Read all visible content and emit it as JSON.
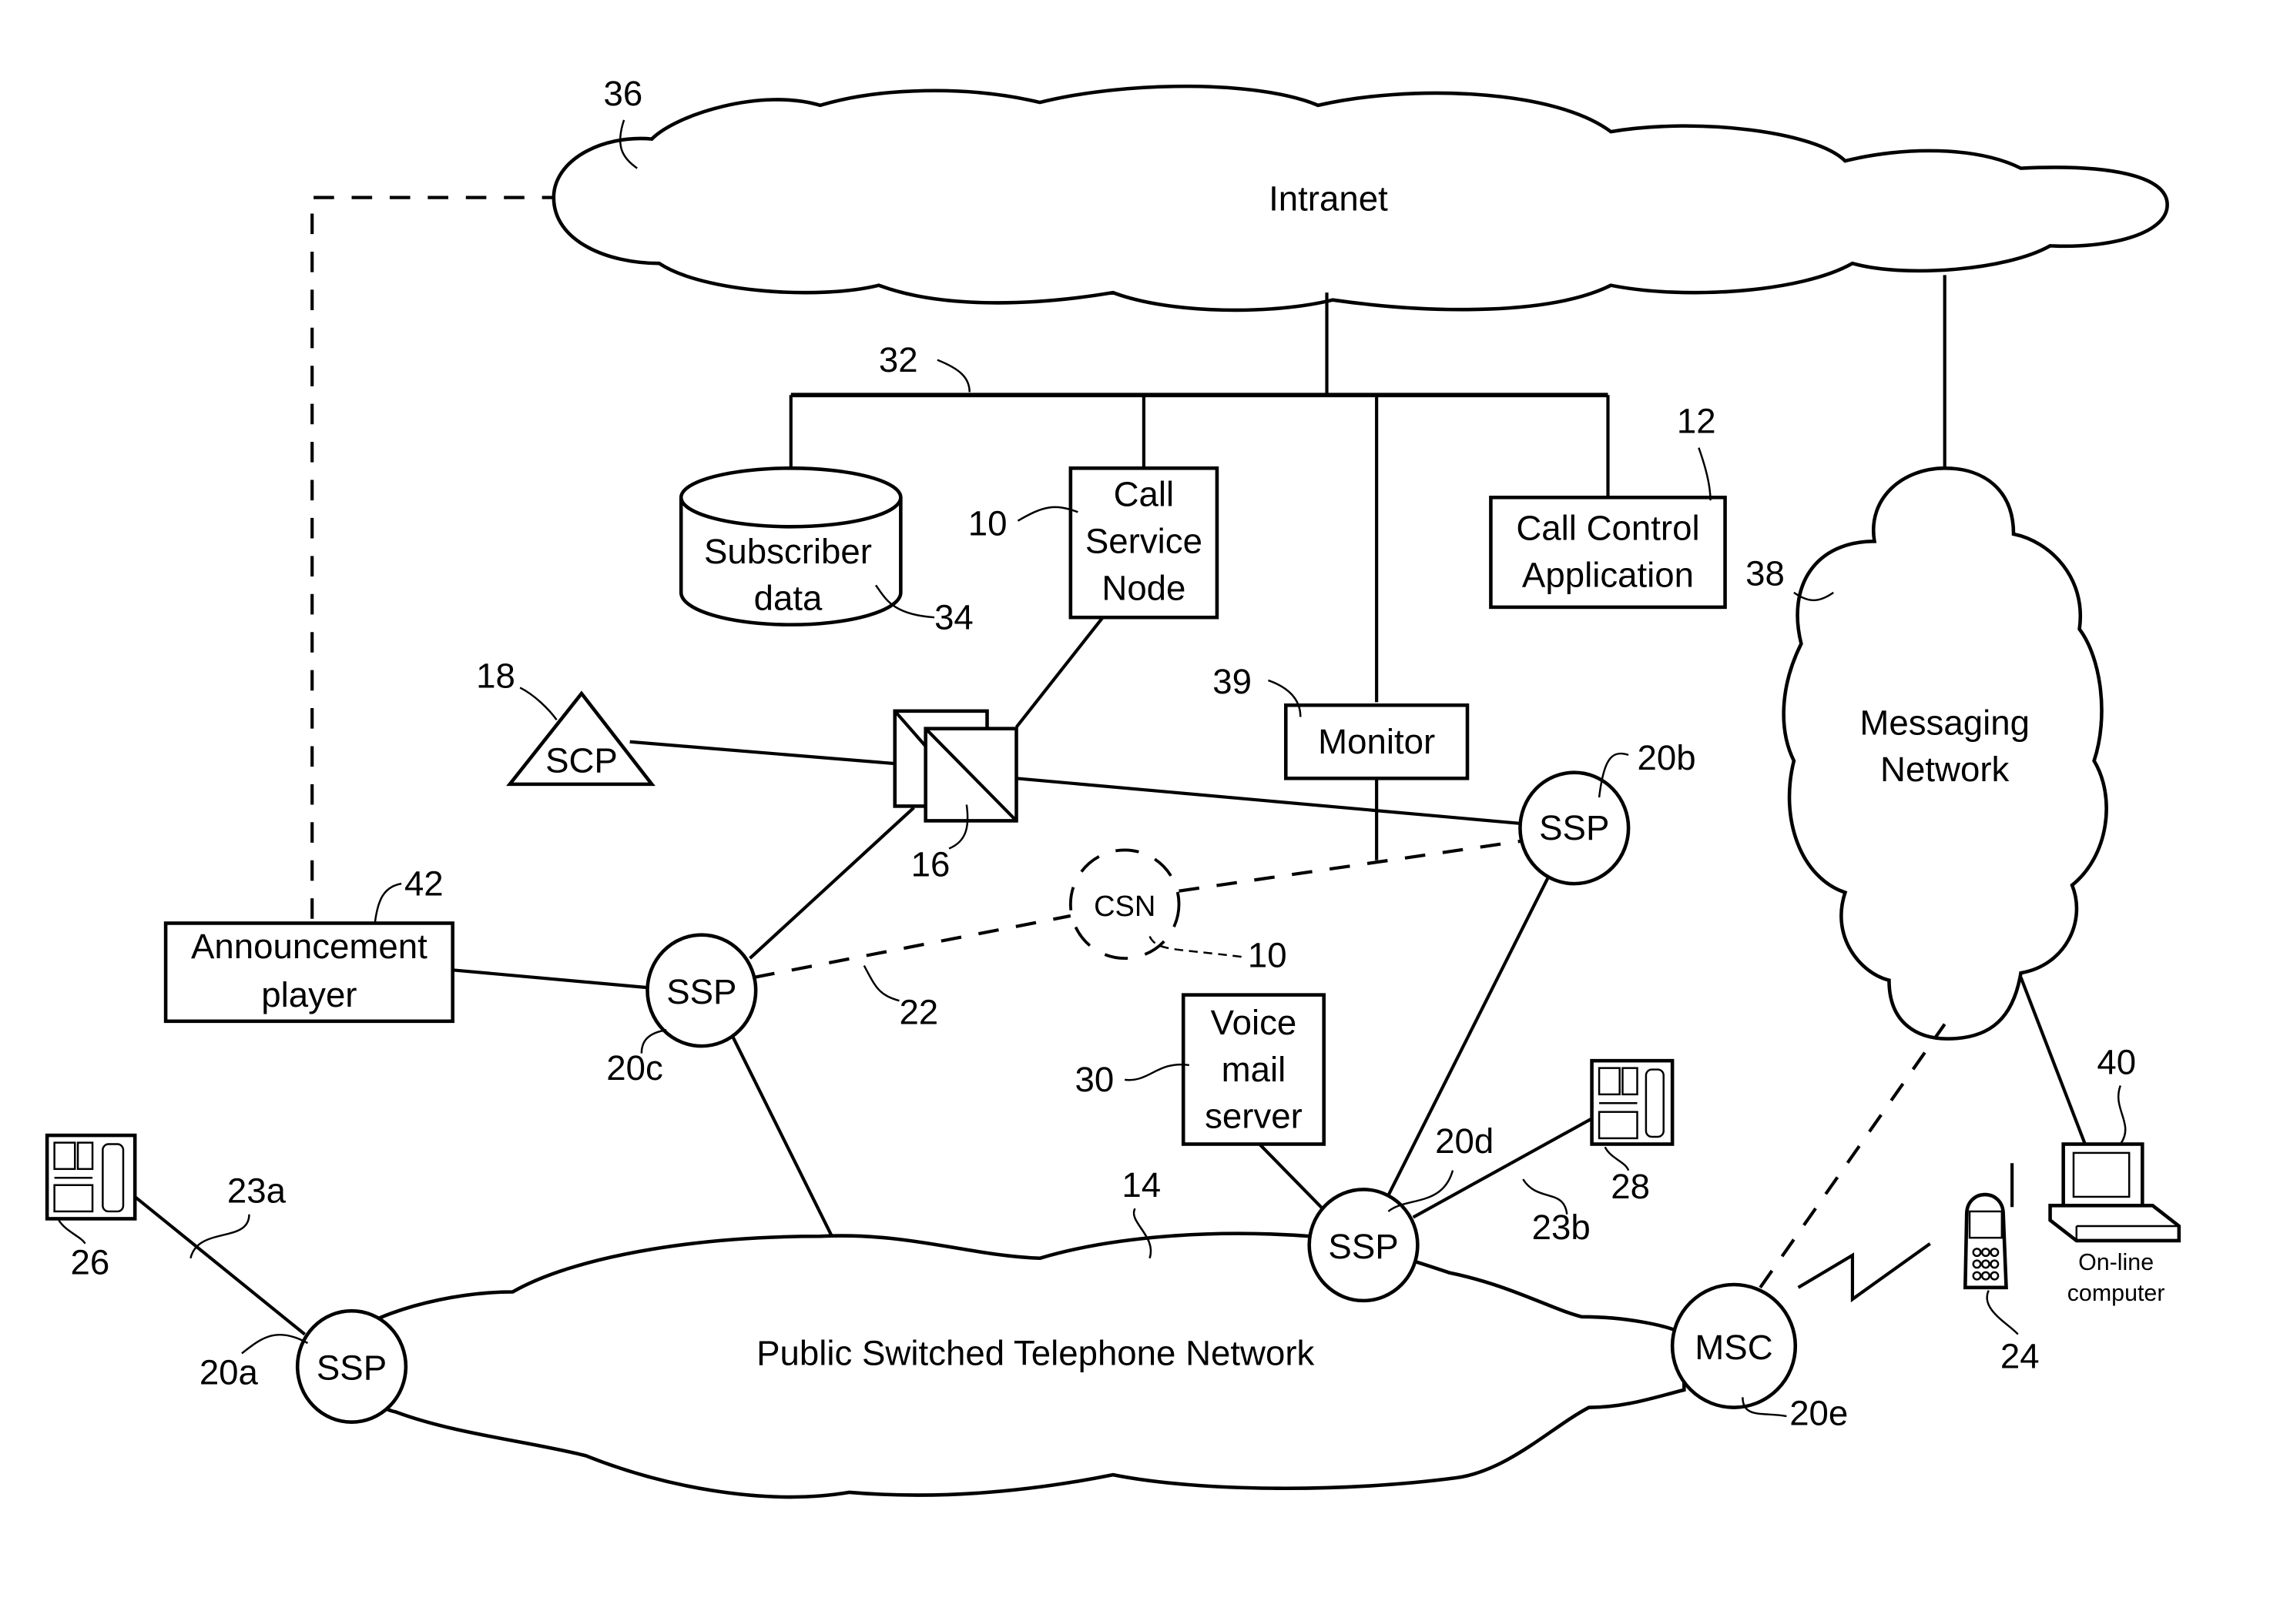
{
  "diagram": {
    "networks": {
      "intranet": {
        "label": "Intranet",
        "ref": "36"
      },
      "pstn": {
        "label": "Public Switched Telephone Network",
        "ref": "14"
      },
      "messaging": {
        "label_line1": "Messaging",
        "label_line2": "Network",
        "ref": "38"
      }
    },
    "bus": {
      "ref": "32"
    },
    "nodes": {
      "subscriber_data": {
        "line1": "Subscriber",
        "line2": "data",
        "ref": "34"
      },
      "call_service_node": {
        "line1": "Call",
        "line2": "Service",
        "line3": "Node",
        "ref": "10"
      },
      "call_control_app": {
        "line1": "Call Control",
        "line2": "Application",
        "ref": "12"
      },
      "monitor": {
        "label": "Monitor",
        "ref": "39"
      },
      "scp": {
        "label": "SCP",
        "ref": "18"
      },
      "switch": {
        "ref": "16"
      },
      "announcement_player": {
        "line1": "Announcement",
        "line2": "player",
        "ref": "42"
      },
      "csn": {
        "label": "CSN",
        "ref": "10"
      },
      "voice_mail": {
        "line1": "Voice",
        "line2": "mail",
        "line3": "server",
        "ref": "30"
      },
      "ssp_20a": {
        "label": "SSP",
        "ref": "20a"
      },
      "ssp_20b": {
        "label": "SSP",
        "ref": "20b"
      },
      "ssp_20c": {
        "label": "SSP",
        "ref": "20c"
      },
      "ssp_20d": {
        "label": "SSP",
        "ref": "20d"
      },
      "msc": {
        "label": "MSC",
        "ref": "20e"
      },
      "phone_26": {
        "ref": "26"
      },
      "phone_28": {
        "ref": "28"
      },
      "mobile": {
        "ref": "24"
      },
      "computer": {
        "line1": "On-line",
        "line2": "computer",
        "ref": "40"
      }
    },
    "links": {
      "dashed_22": {
        "ref": "22"
      },
      "line_23a": {
        "ref": "23a"
      },
      "line_23b": {
        "ref": "23b"
      }
    }
  }
}
